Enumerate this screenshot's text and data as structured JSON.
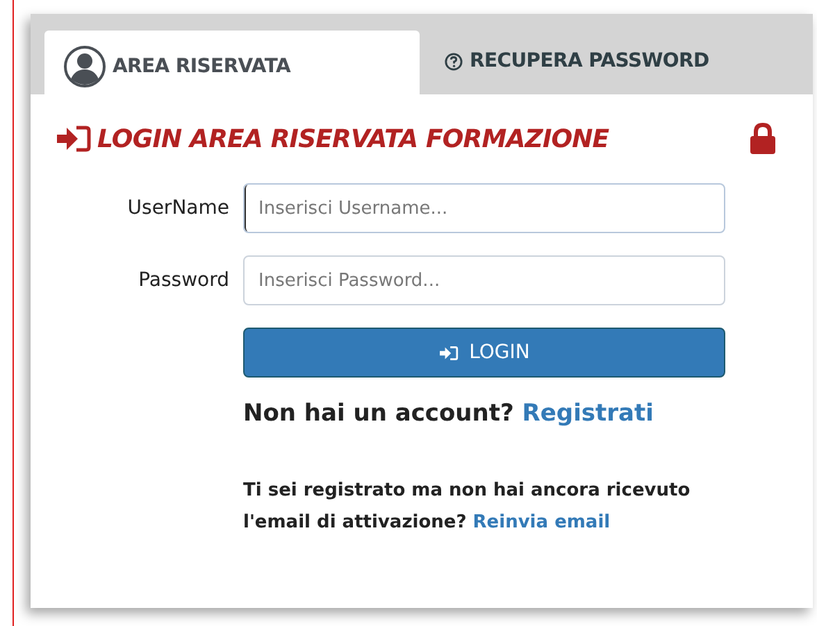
{
  "tabs": [
    {
      "label": "AREA RISERVATA",
      "kind": "user",
      "selected": true
    },
    {
      "label": "RECUPERA PASSWORD",
      "kind": "help",
      "selected": false
    }
  ],
  "heading": {
    "title": "LOGIN AREA RISERVATA FORMAZIONE"
  },
  "fields": [
    {
      "label": "UserName",
      "placeholder": "Inserisci Username...",
      "focused": true
    },
    {
      "label": "Password",
      "placeholder": "Inserisci Password...",
      "focused": false
    }
  ],
  "login_button": "LOGIN",
  "signup": {
    "text": "Non hai un account?",
    "link": "Registrati"
  },
  "resend": {
    "text": "Ti sei registrato ma non hai ancora ricevuto l'email di attivazione?",
    "link": "Reinvia email"
  }
}
